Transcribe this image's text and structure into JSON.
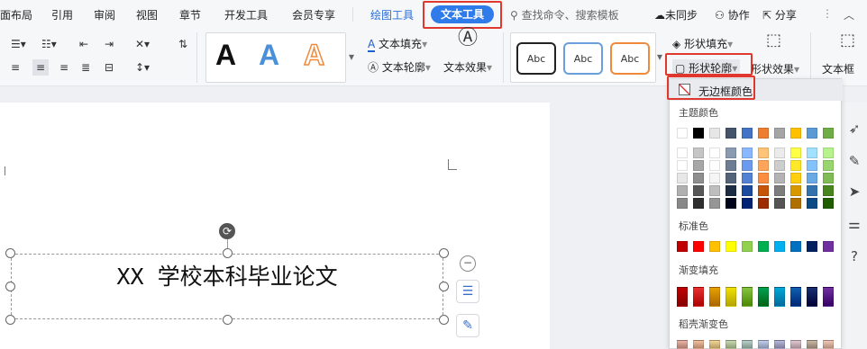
{
  "menu": {
    "tabs": [
      "面布局",
      "引用",
      "审阅",
      "视图",
      "章节",
      "开发工具",
      "会员专享"
    ],
    "draw_tab": "绘图工具",
    "text_tab": "文本工具",
    "search": "查找命令、搜索模板",
    "sync": "未同步",
    "collab": "协作",
    "share": "分享"
  },
  "ribbon": {
    "text_fill": "文本填充",
    "text_outline": "文本轮廓",
    "text_effect": "文本效果",
    "shape_fill": "形状填充",
    "shape_outline": "形状轮廓",
    "shape_effect": "形状效果",
    "textbox": "文本框",
    "styles_big": [
      "A",
      "A",
      "A"
    ],
    "styles_abc": [
      "Abc",
      "Abc",
      "Abc"
    ]
  },
  "document": {
    "title": "XX 学校本科毕业论文"
  },
  "dropdown": {
    "no_border": "无边框颜色",
    "theme": "主题颜色",
    "standard": "标准色",
    "gradient": "渐变填充",
    "shell": "稻壳渐变色",
    "theme_top": [
      "#ffffff",
      "#000000",
      "#e7e6e6",
      "#44546a",
      "#4472c4",
      "#ed7d31",
      "#a5a5a5",
      "#ffc000",
      "#5b9bd5",
      "#70ad47"
    ],
    "standard_colors": [
      "#c00000",
      "#ff0000",
      "#ffc000",
      "#ffff00",
      "#92d050",
      "#00b050",
      "#00b0f0",
      "#0070c0",
      "#002060",
      "#7030a0"
    ],
    "gradient_colors": [
      "#c00000",
      "#e83030",
      "#e6a100",
      "#f0e000",
      "#86c440",
      "#00a050",
      "#00a7d8",
      "#1060b0",
      "#183070",
      "#7030a0"
    ],
    "shell_colors": [
      "#e8b5a8",
      "#f0c0a0",
      "#f1d59a",
      "#c8d8b0",
      "#b8d0c8",
      "#c0cce8",
      "#b8b8d8",
      "#e0c8d0",
      "#c8b8a8",
      "#f0c8b8"
    ]
  }
}
